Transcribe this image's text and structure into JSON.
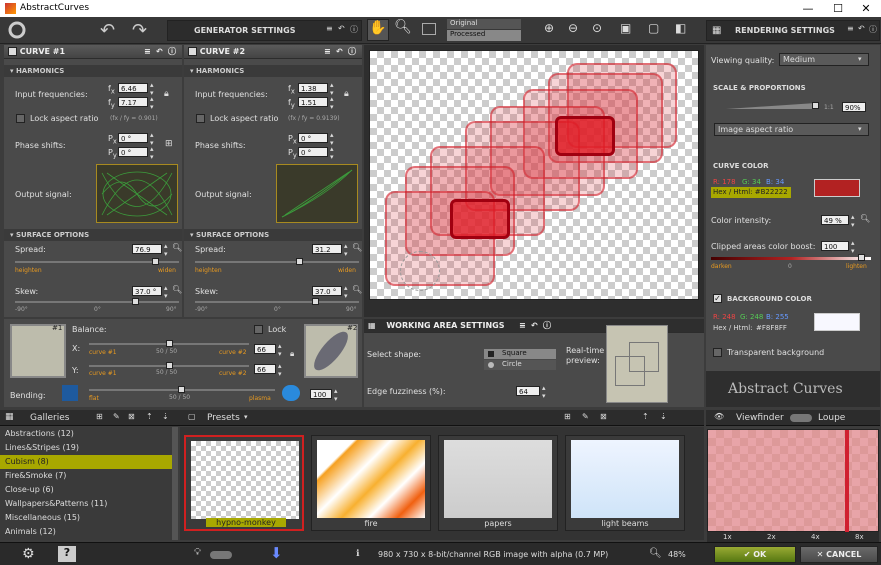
{
  "window": {
    "title": "AbstractCurves",
    "min": "—",
    "max": "☐",
    "close": "✕"
  },
  "toolbar": {
    "generator_settings": "GENERATOR SETTINGS",
    "original": "Original",
    "processed": "Processed",
    "rendering_settings": "RENDERING SETTINGS"
  },
  "curve1": {
    "title": "CURVE #1",
    "harmonics": "HARMONICS",
    "input_freq": "Input frequencies:",
    "fx_label": "f",
    "fx_sub": "x",
    "fx": "6.46",
    "fy_label": "f",
    "fy_sub": "y",
    "fy": "7.17",
    "lock_aspect": "Lock aspect ratio",
    "ratio": "(fx / fy = 0.901)",
    "phase_shifts": "Phase shifts:",
    "px_label": "P",
    "px_sub": "x",
    "px": "0 °",
    "py_label": "P",
    "py_sub": "y",
    "py": "0 °",
    "output_signal": "Output signal:",
    "surface": "SURFACE OPTIONS",
    "spread_label": "Spread:",
    "spread": "76.9",
    "heighten": "heighten",
    "widen": "widen",
    "skew_label": "Skew:",
    "skew": "37.0 °",
    "m90": "-90°",
    "zero": "0°",
    "p90": "90°"
  },
  "curve2": {
    "title": "CURVE #2",
    "harmonics": "HARMONICS",
    "input_freq": "Input frequencies:",
    "fx_label": "f",
    "fx_sub": "x",
    "fx": "1.38",
    "fy_label": "f",
    "fy_sub": "y",
    "fy": "1.51",
    "lock_aspect": "Lock aspect ratio",
    "ratio": "(fx / fy = 0.9139)",
    "phase_shifts": "Phase shifts:",
    "px_label": "P",
    "px_sub": "x",
    "px": "0 °",
    "py_label": "P",
    "py_sub": "y",
    "py": "0 °",
    "output_signal": "Output signal:",
    "surface": "SURFACE OPTIONS",
    "spread_label": "Spread:",
    "spread": "31.2",
    "heighten": "heighten",
    "widen": "widen",
    "skew_label": "Skew:",
    "skew": "37.0 °",
    "m90": "-90°",
    "zero": "0°",
    "p90": "90°"
  },
  "balance": {
    "label": "Balance:",
    "lock": "Lock",
    "x_label": "X:",
    "y_label": "Y:",
    "curve1": "curve #1",
    "curve2": "curve #2",
    "ratio_x": "50 / 50",
    "ratio_y": "50 / 50",
    "x_val": "66",
    "y_val": "66",
    "badge1": "#1",
    "badge2": "#2",
    "bending_label": "Bending:",
    "flat": "flat",
    "plasma": "plasma",
    "bend_ratio": "50 / 50",
    "bend_val": "100"
  },
  "working_area": {
    "title": "WORKING AREA SETTINGS",
    "select_shape": "Select shape:",
    "square": "Square",
    "circle": "Circle",
    "realtime": "Real-time",
    "preview": "preview:",
    "edge_label": "Edge fuzziness (%):",
    "edge_val": "64"
  },
  "rendering": {
    "viewing_quality_label": "Viewing quality:",
    "viewing_quality": "Medium",
    "scale_title": "SCALE & PROPORTIONS",
    "one_to_one": "1:1",
    "scale_pct": "90%",
    "aspect_select": "Image aspect ratio",
    "curve_color_title": "CURVE COLOR",
    "r": "R: 178",
    "g": "G: 34",
    "b": "B: 34",
    "hex_label": "Hex / Html:",
    "hex": "#B22222",
    "curve_color": "#B22222",
    "intensity_label": "Color intensity:",
    "intensity": "49 %",
    "boost_label": "Clipped areas color boost:",
    "boost": "100",
    "darken": "darken",
    "zero": "0",
    "lighten": "lighten",
    "bg_title": "BACKGROUND COLOR",
    "bg_r": "R: 248",
    "bg_g": "G: 248",
    "bg_b": "B: 255",
    "bg_hex_label": "Hex / Html:",
    "bg_hex": "#F8F8FF",
    "bg_color": "#F8F8FF",
    "transparent": "Transparent background",
    "logo": "Abstract Curves"
  },
  "galleries": {
    "title": "Galleries",
    "items": [
      "Abstractions (12)",
      "Lines&Stripes (19)",
      "Cubism (8)",
      "Fire&Smoke (7)",
      "Close-up (6)",
      "Wallpapers&Patterns (11)",
      "Miscellaneous (15)",
      "Animals (12)"
    ],
    "selected_index": 2
  },
  "presets": {
    "title": "Presets",
    "items": [
      "hypno-monkey",
      "fire",
      "papers",
      "light beams"
    ]
  },
  "viewfinder": {
    "title": "Viewfinder",
    "loupe": "Loupe",
    "zooms": [
      "1x",
      "2x",
      "4x",
      "8x"
    ]
  },
  "status": {
    "info": "980 x 730 x 8-bit/channel RGB image with alpha  (0.7 MP)",
    "zoom": "48%",
    "ok": "OK",
    "cancel": "CANCEL"
  }
}
